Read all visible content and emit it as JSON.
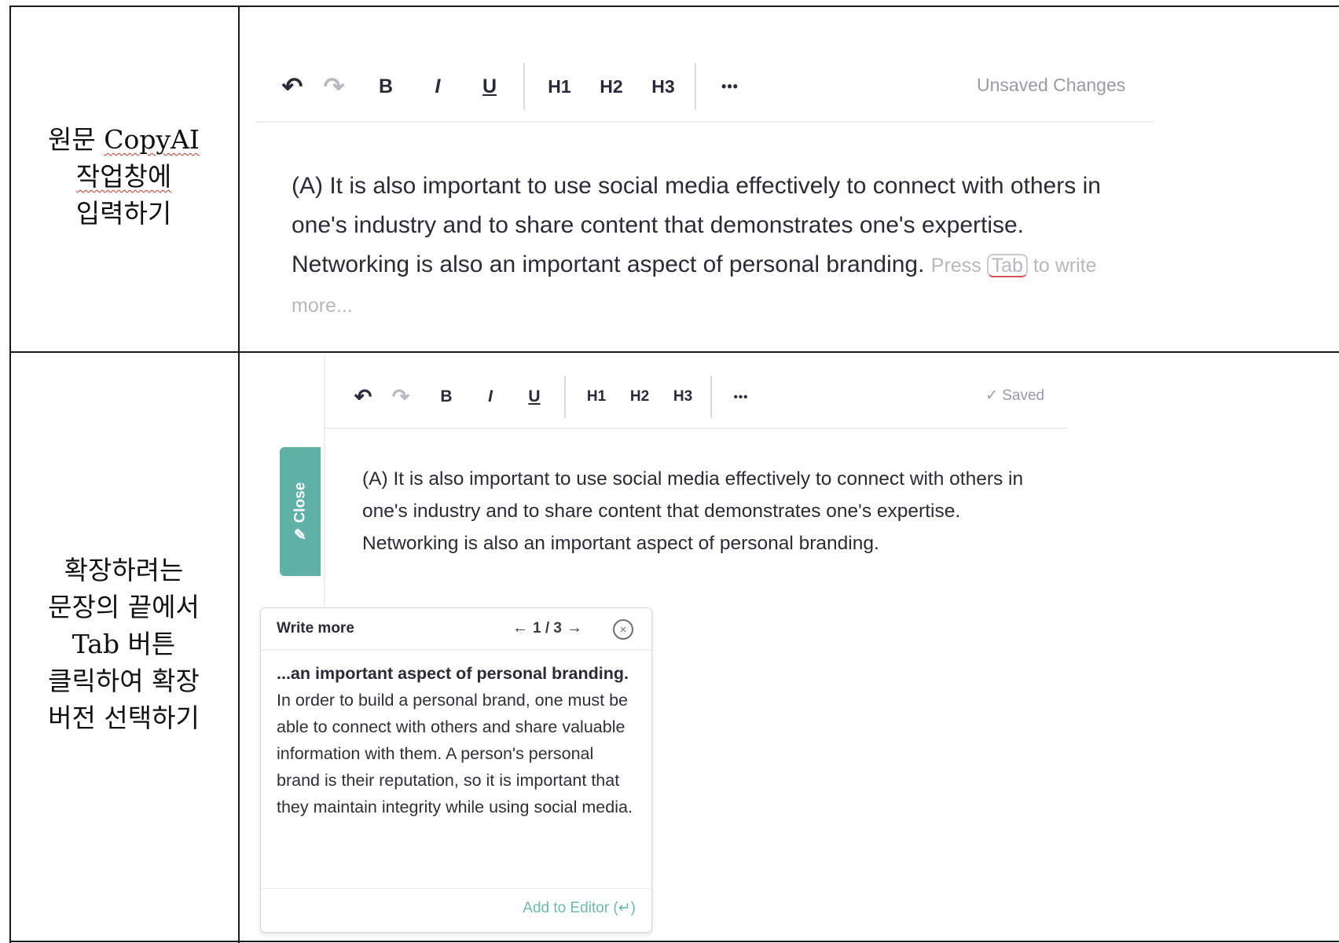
{
  "row1": {
    "label_lines": [
      "원문 CopyAI",
      "작업창에",
      "입력하기"
    ],
    "toolbar": {
      "undo": "↶",
      "redo": "↷",
      "bold": "B",
      "italic": "I",
      "underline": "U",
      "h1": "H1",
      "h2": "H2",
      "h3": "H3",
      "more": "•••",
      "status": "Unsaved Changes"
    },
    "editor": {
      "text": "(A) It is also important to use social media effectively to connect with others in one's industry and to share content that demonstrates one's expertise. Networking is also an important aspect of personal branding.",
      "hint_prefix": "Press",
      "hint_key": "Tab",
      "hint_suffix": "to write more..."
    }
  },
  "row2": {
    "label_lines": [
      "확장하려는",
      "문장의 끝에서",
      "Tab 버튼",
      "클릭하여 확장",
      "버전 선택하기"
    ],
    "toolbar": {
      "undo": "↶",
      "redo": "↷",
      "bold": "B",
      "italic": "I",
      "underline": "U",
      "h1": "H1",
      "h2": "H2",
      "h3": "H3",
      "more": "•••",
      "status_check": "✓",
      "status": "Saved"
    },
    "close_tab": {
      "label": "Close",
      "icon": "✎"
    },
    "editor": {
      "text": "(A) It is also important to use social media effectively to connect with others in one's industry and to share content that demonstrates one's expertise. Networking is also an important aspect of personal branding."
    },
    "popup": {
      "title": "Write more",
      "nav_prev": "←",
      "nav_position": "1 / 3",
      "nav_next": "→",
      "close": "×",
      "bold_text": "...an important aspect of personal branding.",
      "text": "In order to build a personal brand, one must be able to connect with others and share valuable information with them. A person's personal brand is their reputation, so it is important that they maintain integrity while using social media.",
      "add_label": "Add to Editor",
      "add_shortcut": "(↵)"
    }
  }
}
